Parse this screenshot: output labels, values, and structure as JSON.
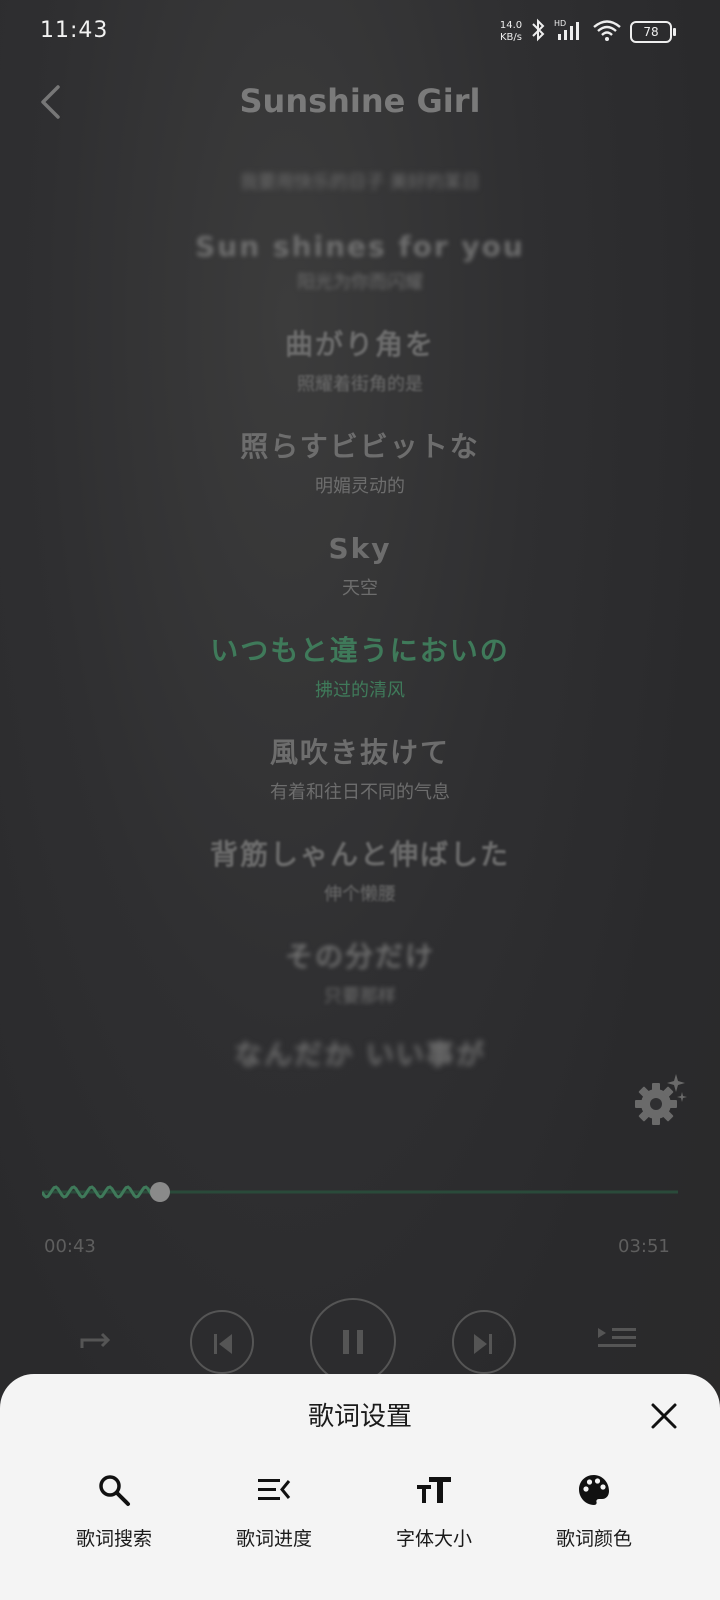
{
  "status_bar": {
    "time": "11:43",
    "net_speed_value": "14.0",
    "net_speed_unit": "KB/s",
    "battery": "78"
  },
  "header": {
    "title": "Sunshine Girl"
  },
  "lyrics": [
    {
      "orig": "",
      "trans": "我要用快乐的日子 美好的某日"
    },
    {
      "orig": "Sun shines for you",
      "trans": "阳光为你而闪耀"
    },
    {
      "orig": "曲がり角を",
      "trans": "照耀着街角的是"
    },
    {
      "orig": "照らすビビットな",
      "trans": "明媚灵动的"
    },
    {
      "orig": "Sky",
      "trans": "天空"
    },
    {
      "orig": "いつもと違うにおいの",
      "trans": "拂过的清风"
    },
    {
      "orig": "風吹き抜けて",
      "trans": "有着和往日不同的气息"
    },
    {
      "orig": "背筋しゃんと伸ばした",
      "trans": "伸个懒腰"
    },
    {
      "orig": "その分だけ",
      "trans": "只要那样"
    },
    {
      "orig": "なんだか いい事が",
      "trans": ""
    }
  ],
  "active_lyric_index": 5,
  "player": {
    "current_time": "00:43",
    "total_time": "03:51",
    "progress": 0.186
  },
  "sheet": {
    "title": "歌词设置",
    "options": [
      {
        "label": "歌词搜索",
        "icon": "search-icon"
      },
      {
        "label": "歌词进度",
        "icon": "lyric-progress-icon"
      },
      {
        "label": "字体大小",
        "icon": "font-size-icon"
      },
      {
        "label": "歌词颜色",
        "icon": "palette-icon"
      }
    ]
  },
  "colors": {
    "accent": "#3f7a5a",
    "sheet_bg": "#f4f4f4"
  }
}
